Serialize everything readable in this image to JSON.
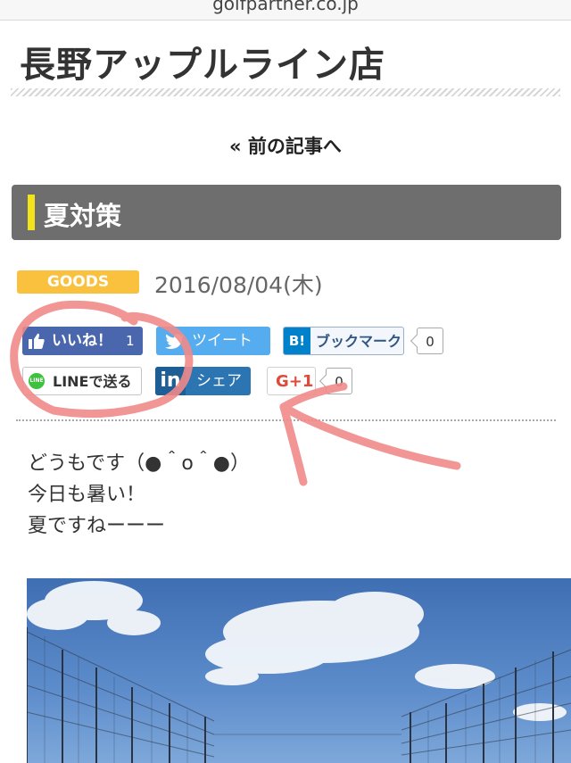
{
  "browser": {
    "url": "golfpartner.co.jp"
  },
  "site": {
    "title": "長野アップルライン店"
  },
  "nav": {
    "prev_label": "« 前の記事へ"
  },
  "post": {
    "title": "夏対策",
    "category": "GOODS",
    "date": "2016/08/04(木)",
    "body": [
      "どうもです（●＾o＾●）",
      "今日も暑い！",
      "夏ですねーーー"
    ]
  },
  "share": {
    "like_label": "いいね！",
    "like_count": "1",
    "tweet_label": "ツイート",
    "hatena_icon_text": "B!",
    "hatena_label": "ブックマーク",
    "hatena_count": "0",
    "line_label": "LINEで送る",
    "line_icon_text": "LINE",
    "linkedin_icon_text": "in",
    "linkedin_label": "シェア",
    "gplus_label": "G+1",
    "gplus_count": "0"
  },
  "colors": {
    "header_bg": "#6e6e6e",
    "header_accent": "#f2e31a",
    "category_badge": "#f9c13e",
    "facebook": "#4a67ad",
    "twitter": "#55acee",
    "linkedin": "#2a75b2",
    "gplus": "#dd4b39",
    "annotation": "#f08a8a"
  },
  "annotations": [
    "circle-around-like-and-line-buttons",
    "arrow-pointing-to-gplus-button"
  ]
}
